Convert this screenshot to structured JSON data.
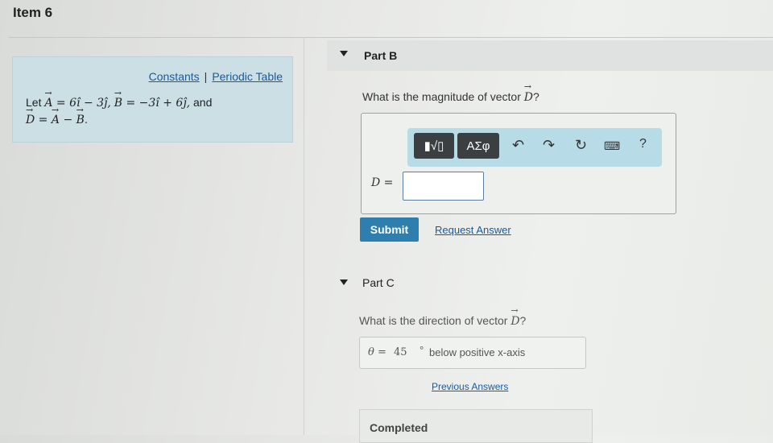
{
  "header": {
    "item_title": "Item 6"
  },
  "sidebar": {
    "links": {
      "constants": "Constants",
      "separator": "|",
      "periodic_table": "Periodic Table"
    },
    "problem": {
      "let": "Let",
      "a_var": "A",
      "a_expr": " = 6î − 3ĵ,",
      "b_var": "B",
      "b_expr": " = −3î + 6ĵ,",
      "and": " and",
      "d_var": "D",
      "d_eq": " = ",
      "d_a": "A",
      "d_minus": " − ",
      "d_b": "B",
      "period": "."
    }
  },
  "part_b": {
    "label": "Part B",
    "question_prefix": "What is the magnitude of vector ",
    "question_var": "D",
    "question_suffix": "?",
    "toolbar": {
      "templates_label": "▮√▯",
      "symbols_label": "ΑΣφ",
      "undo_icon": "undo-icon",
      "redo_icon": "redo-icon",
      "reset_icon": "reset-icon",
      "keyboard_icon": "keyboard-icon",
      "help_label": "?"
    },
    "answer_label": "D =",
    "answer_value": "",
    "submit_label": "Submit",
    "request_answer_label": "Request Answer"
  },
  "part_c": {
    "label": "Part C",
    "question_prefix": "What is the direction of vector ",
    "question_var": "D",
    "question_suffix": "?",
    "theta_label": "θ =",
    "theta_value": "45",
    "theta_unit": "°",
    "theta_desc": "below positive x-axis",
    "previous_answers_label": "Previous Answers",
    "status": "Completed"
  }
}
